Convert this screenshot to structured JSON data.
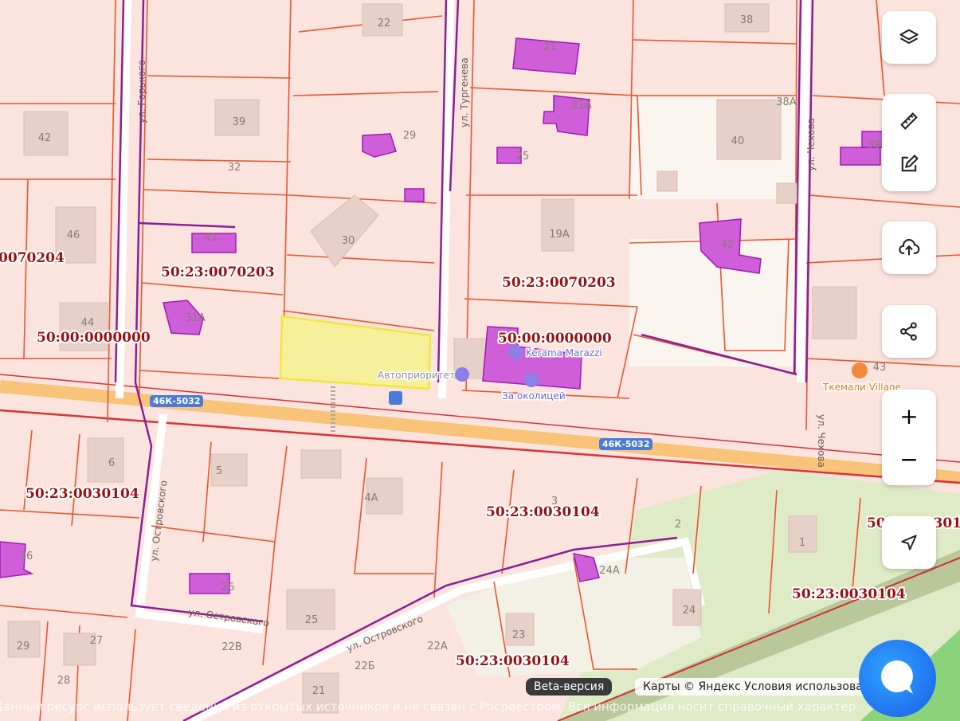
{
  "parcels": {
    "labels": [
      {
        "text": "50:23:0070203"
      },
      {
        "text": "50:23:0070203"
      },
      {
        "text": "0070204"
      },
      {
        "text": "50:00:0000000"
      },
      {
        "text": "50:00:0000000"
      },
      {
        "text": "50:23:0030104"
      },
      {
        "text": "50:23:0030104"
      },
      {
        "text": "50:23:0030104"
      },
      {
        "text": "50:23:0030104"
      },
      {
        "text": "50:23:00301"
      }
    ]
  },
  "house_numbers": [
    "22",
    "21",
    "38",
    "42",
    "39",
    "29",
    "32",
    "21А",
    "25",
    "38А",
    "40",
    "39",
    "46",
    "41",
    "30",
    "19А",
    "42",
    "44",
    "31А",
    "43",
    "6",
    "5",
    "4А",
    "3",
    "2",
    "1",
    "36",
    "26",
    "25",
    "24",
    "24А",
    "23",
    "22А",
    "22Б",
    "21",
    "29",
    "27",
    "28",
    "22В"
  ],
  "streets": {
    "gorkogo": "ул. Горького",
    "turgeneva": "ул. Тургенева",
    "chekhova": "ул. Чехова",
    "chekhova2": "ул. Чехова",
    "ostrovskogo": "ул. Островского",
    "ostrovskogo2": "ул. Островского",
    "ostrovskogo3": "ул. Островского"
  },
  "pois": {
    "avtoprioritet": "Автоприоритет",
    "kerama": "Kerama Marazzi",
    "zaokolitsey": "За околицей",
    "tkemali": "Ткемали Village"
  },
  "roads": {
    "shield1": "46К-5032",
    "shield2": "46К-5032"
  },
  "controls": {
    "layers": "layers-icon",
    "ruler": "ruler-icon",
    "edit": "edit-icon",
    "upload": "upload-icon",
    "share": "share-icon",
    "zoom_in": "+",
    "zoom_out": "−",
    "locate": "locate-icon"
  },
  "footer": {
    "beta": "Beta-версия",
    "copyright": "Карты © Яндекс   Условия использования",
    "disclaimer": "Данный ресурс использует сведения из открытых источников и не связан с Росреестром. Вся информация носит справочный характер"
  },
  "colors": {
    "parcel": "#e8552e",
    "purple": "#8a1f96",
    "selected": "#f7f09a",
    "road": "#f9c47a"
  }
}
